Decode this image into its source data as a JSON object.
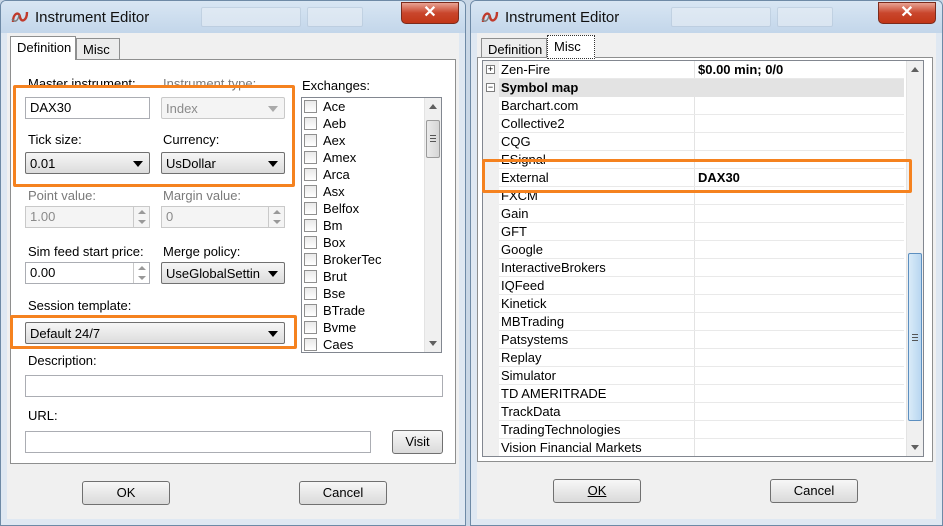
{
  "left_window": {
    "title": "Instrument Editor",
    "tabs": [
      "Definition",
      "Misc"
    ],
    "master_instrument": {
      "label": "Master instrument:",
      "value": "DAX30"
    },
    "instrument_type": {
      "label": "Instrument type:",
      "value": "Index"
    },
    "tick_size": {
      "label": "Tick size:",
      "value": "0.01"
    },
    "currency": {
      "label": "Currency:",
      "value": "UsDollar"
    },
    "point_value": {
      "label": "Point value:",
      "value": "1.00"
    },
    "margin_value": {
      "label": "Margin value:",
      "value": "0"
    },
    "sim_feed_start_price": {
      "label": "Sim feed start price:",
      "value": "0.00"
    },
    "merge_policy": {
      "label": "Merge policy:",
      "value": "UseGlobalSettin"
    },
    "session_template": {
      "label": "Session template:",
      "value": "Default 24/7"
    },
    "description": {
      "label": "Description:",
      "value": ""
    },
    "url": {
      "label": "URL:",
      "value": ""
    },
    "visit_label": "Visit",
    "exchanges_label": "Exchanges:",
    "exchanges": [
      "Ace",
      "Aeb",
      "Aex",
      "Amex",
      "Arca",
      "Asx",
      "Belfox",
      "Bm",
      "Box",
      "BrokerTec",
      "Brut",
      "Bse",
      "BTrade",
      "Bvme",
      "Caes"
    ],
    "ok_label": "OK",
    "cancel_label": "Cancel"
  },
  "right_window": {
    "title": "Instrument Editor",
    "tabs": [
      "Definition",
      "Misc"
    ],
    "grid_top_row": {
      "name": "Zen-Fire",
      "value": "$0.00 min;  0/0"
    },
    "category": "Symbol map",
    "symbol_map": [
      {
        "name": "Barchart.com",
        "value": ""
      },
      {
        "name": "Collective2",
        "value": ""
      },
      {
        "name": "CQG",
        "value": ""
      },
      {
        "name": "ESignal",
        "value": ""
      },
      {
        "name": "External",
        "value": "DAX30"
      },
      {
        "name": "FXCM",
        "value": ""
      },
      {
        "name": "Gain",
        "value": ""
      },
      {
        "name": "GFT",
        "value": ""
      },
      {
        "name": "Google",
        "value": ""
      },
      {
        "name": "InteractiveBrokers",
        "value": ""
      },
      {
        "name": "IQFeed",
        "value": ""
      },
      {
        "name": "Kinetick",
        "value": ""
      },
      {
        "name": "MBTrading",
        "value": ""
      },
      {
        "name": "Patsystems",
        "value": ""
      },
      {
        "name": "Replay",
        "value": ""
      },
      {
        "name": "Simulator",
        "value": ""
      },
      {
        "name": "TD AMERITRADE",
        "value": ""
      },
      {
        "name": "TrackData",
        "value": ""
      },
      {
        "name": "TradingTechnologies",
        "value": ""
      },
      {
        "name": "Vision Financial Markets",
        "value": ""
      }
    ],
    "ok_label": "OK",
    "cancel_label": "Cancel"
  },
  "colors": {
    "highlight": "#f5821f",
    "close_button": "#c9462c"
  }
}
